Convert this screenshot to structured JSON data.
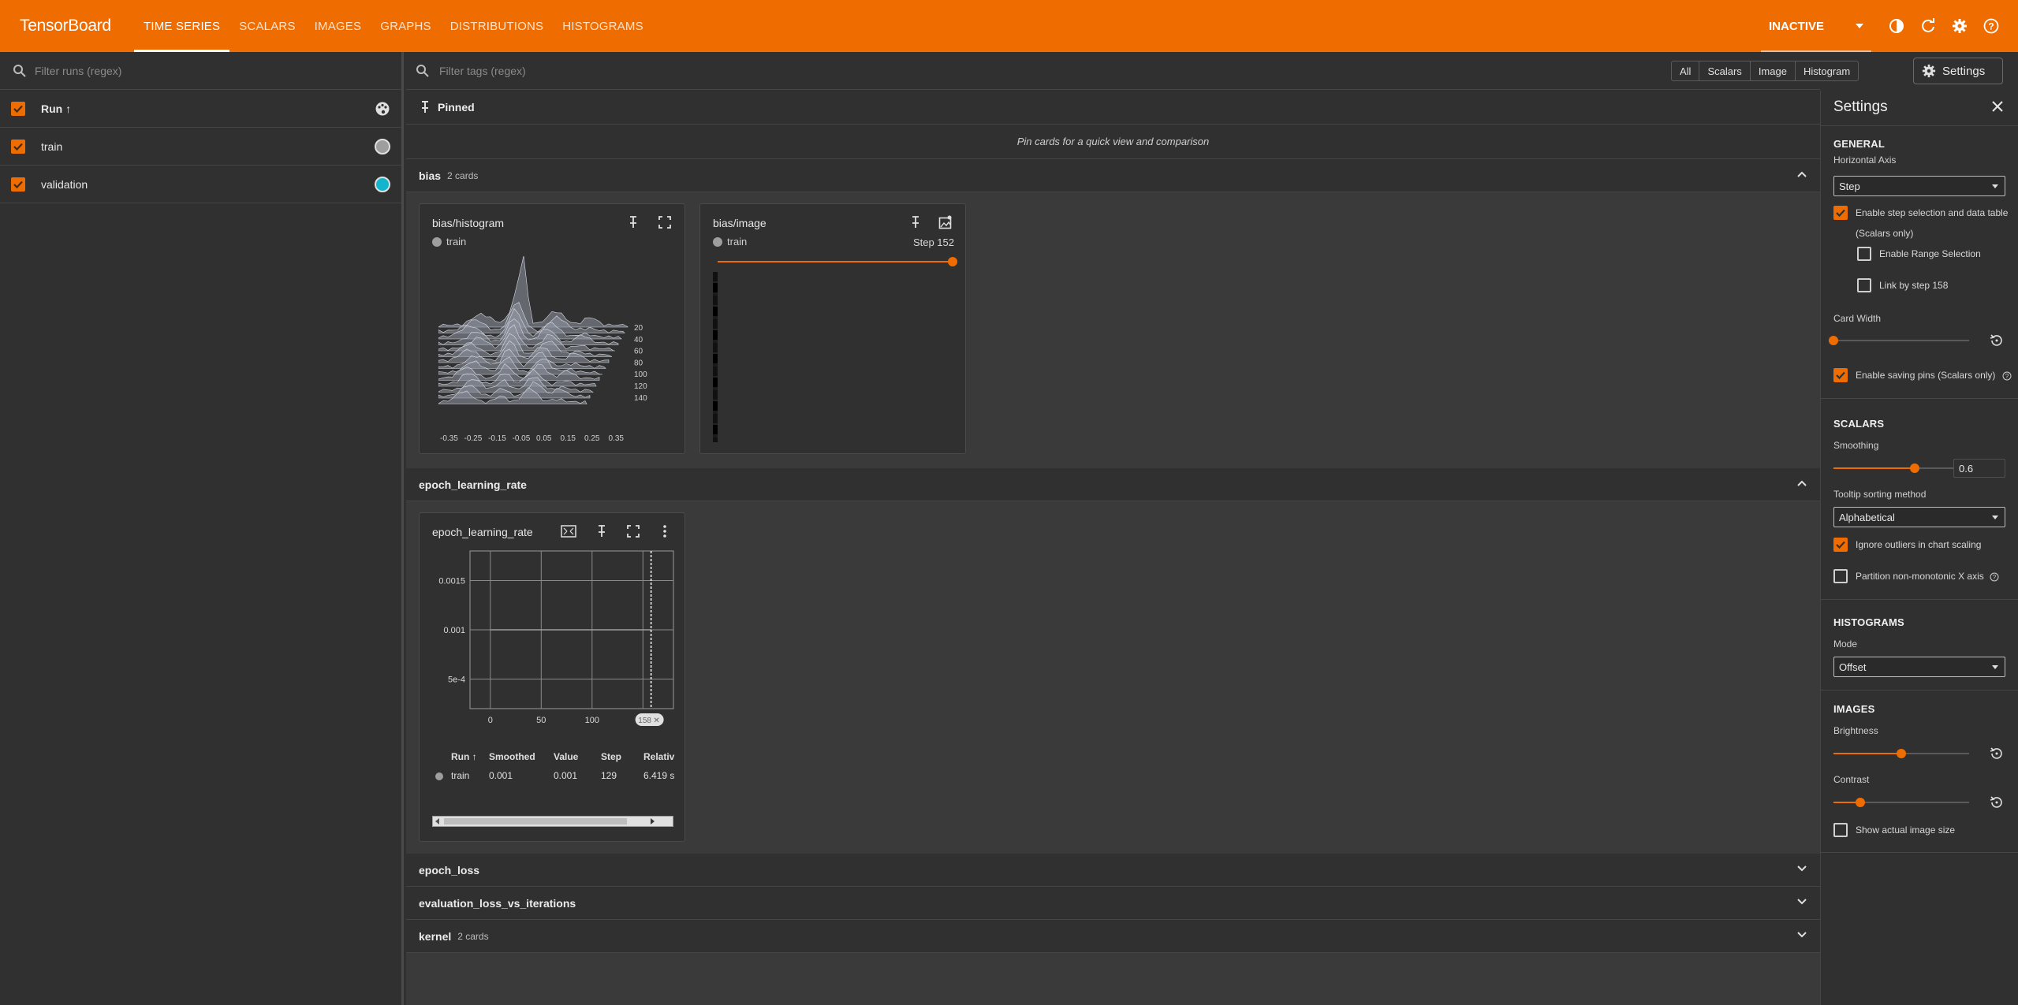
{
  "app": {
    "brand": "TensorBoard",
    "nav_tabs": [
      "TIME SERIES",
      "SCALARS",
      "IMAGES",
      "GRAPHS",
      "DISTRIBUTIONS",
      "HISTOGRAMS"
    ],
    "status": "INACTIVE",
    "accent_color": "#ef6c00"
  },
  "sidebar": {
    "filter_placeholder": "Filter runs (regex)",
    "header_label": "Run ↑",
    "runs": [
      {
        "name": "train",
        "color": "#9e9e9e"
      },
      {
        "name": "validation",
        "color": "#12b5cb"
      }
    ]
  },
  "toolbar": {
    "filter_placeholder": "Filter tags (regex)",
    "type_buttons": [
      "All",
      "Scalars",
      "Image",
      "Histogram"
    ],
    "settings_label": "Settings"
  },
  "pinned": {
    "title": "Pinned",
    "hint": "Pin cards for a quick view and comparison"
  },
  "groups": {
    "bias": {
      "title": "bias",
      "count": "2 cards"
    },
    "epoch_learning_rate": {
      "title": "epoch_learning_rate"
    },
    "epoch_loss": {
      "title": "epoch_loss"
    },
    "evaluation_loss": {
      "title": "evaluation_loss_vs_iterations"
    },
    "kernel": {
      "title": "kernel",
      "count": "2 cards"
    }
  },
  "cards": {
    "histogram": {
      "title": "bias/histogram",
      "run": "train",
      "x_ticks": [
        "-0.35",
        "-0.25",
        "-0.15",
        "-0.05",
        "0.05",
        "0.15",
        "0.25",
        "0.35"
      ],
      "step_ticks": [
        "20",
        "40",
        "60",
        "80",
        "100",
        "120",
        "140"
      ]
    },
    "image": {
      "title": "bias/image",
      "run": "train",
      "step_label": "Step 152"
    },
    "lr": {
      "title": "epoch_learning_rate",
      "table_headers": [
        "Run ↑",
        "Smoothed",
        "Value",
        "Step",
        "Relativ"
      ],
      "table_row": {
        "run": "train",
        "smoothed": "0.001",
        "value": "0.001",
        "step": "129",
        "relative": "6.419 s"
      },
      "step_marker": "158"
    }
  },
  "chart_data": {
    "type": "line",
    "title": "epoch_learning_rate",
    "x": [
      0,
      50,
      100,
      129,
      158
    ],
    "series": [
      {
        "name": "train",
        "values": [
          0.001,
          0.001,
          0.001,
          0.001,
          0.001
        ]
      }
    ],
    "x_ticks": [
      "0",
      "50",
      "100"
    ],
    "y_ticks": [
      "5e-4",
      "0.001",
      "0.0015"
    ],
    "xlim": [
      -20,
      180
    ],
    "ylim": [
      0.0002,
      0.0018
    ],
    "grid": true
  },
  "settings": {
    "title": "Settings",
    "general": {
      "heading": "GENERAL",
      "horizontal_axis_label": "Horizontal Axis",
      "horizontal_axis_value": "Step",
      "step_selection_label": "Enable step selection and data table",
      "scalars_only": "(Scalars only)",
      "range_selection_label": "Enable Range Selection",
      "link_by_step_label": "Link by step 158",
      "card_width_label": "Card Width",
      "card_width_level": 0,
      "saving_pins_label": "Enable saving pins (Scalars only)"
    },
    "scalars": {
      "heading": "SCALARS",
      "smoothing_label": "Smoothing",
      "smoothing_value": "0.6",
      "smoothing_level": 0.6,
      "tooltip_label": "Tooltip sorting method",
      "tooltip_value": "Alphabetical",
      "ignore_outliers_label": "Ignore outliers in chart scaling",
      "partition_label": "Partition non-monotonic X axis"
    },
    "histograms": {
      "heading": "HISTOGRAMS",
      "mode_label": "Mode",
      "mode_value": "Offset"
    },
    "images": {
      "heading": "IMAGES",
      "brightness_label": "Brightness",
      "brightness_level": 0.5,
      "contrast_label": "Contrast",
      "contrast_level": 0.2,
      "actual_size_label": "Show actual image size"
    }
  }
}
